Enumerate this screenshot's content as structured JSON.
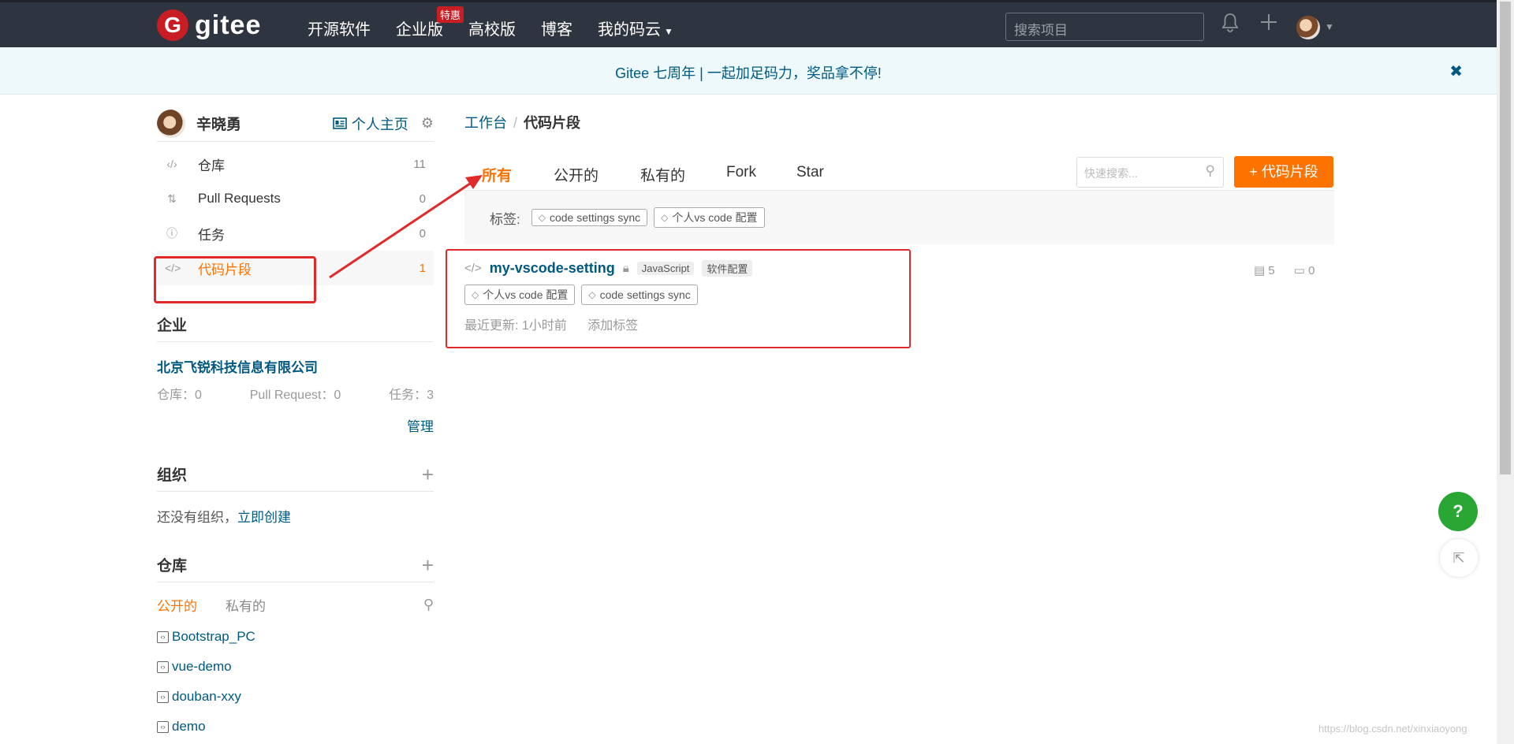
{
  "topbar": {
    "logo_mark": "G",
    "logo_text": "gitee",
    "nav": [
      "开源软件",
      "企业版",
      "高校版",
      "博客",
      "我的码云"
    ],
    "enterprise_badge": "特惠",
    "search_placeholder": "搜索项目",
    "icons": [
      "bell-icon",
      "plus-icon",
      "avatar",
      "chevron-down-icon"
    ]
  },
  "notice": {
    "text": "Gitee 七周年 | 一起加足码力，奖品拿不停!",
    "close": "✖"
  },
  "sidebar": {
    "user_name": "辛晓勇",
    "home_label": "个人主页",
    "menu": [
      {
        "label": "仓库",
        "count": "11"
      },
      {
        "label": "Pull Requests",
        "count": "0"
      },
      {
        "label": "任务",
        "count": "0"
      },
      {
        "label": "代码片段",
        "count": "1"
      }
    ],
    "enterprise": {
      "title": "企业",
      "name": "北京飞锐科技信息有限公司",
      "repos": "仓库：0",
      "prs": "Pull Request：0",
      "tasks": "任务：3",
      "manage": "管理"
    },
    "org": {
      "title": "组织",
      "empty_text": "还没有组织，",
      "create_link": "立即创建"
    },
    "repo": {
      "title": "仓库",
      "tab_public": "公开的",
      "tab_private": "私有的",
      "items": [
        "Bootstrap_PC",
        "vue-demo",
        "douban-xxy",
        "demo"
      ]
    }
  },
  "main": {
    "crumb_root": "工作台",
    "crumb_current": "代码片段",
    "tabs": [
      "所有",
      "公开的",
      "私有的",
      "Fork",
      "Star"
    ],
    "quick_search_placeholder": "快速搜索...",
    "new_button": "+ 代码片段",
    "tag_label": "标签:",
    "tags": [
      "code settings sync",
      "个人vs code 配置"
    ],
    "snippet": {
      "name": "my-vscode-setting",
      "lang": "JavaScript",
      "category": "软件配置",
      "tags": [
        "个人vs code 配置",
        "code settings sync"
      ],
      "updated": "最近更新: 1小时前",
      "add_tag": "添加标签",
      "files": "5",
      "comments": "0"
    }
  },
  "fab": {
    "help": "?"
  },
  "watermark": "https://blog.csdn.net/xinxiaoyong"
}
